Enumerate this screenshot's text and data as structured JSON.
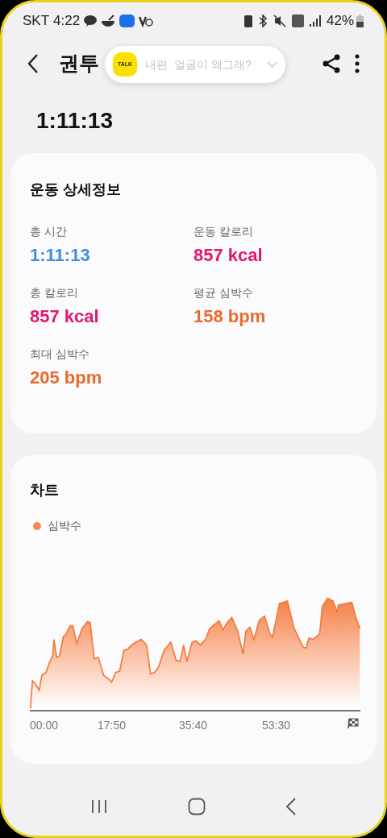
{
  "status_bar": {
    "carrier": "SKT",
    "time": "4:22",
    "battery": "42%"
  },
  "notification": {
    "logo": "TALK",
    "sender": "내편",
    "message": "얼굴이 왜그래?"
  },
  "header": {
    "title": "권투"
  },
  "duration": "1:11:13",
  "details": {
    "title": "운동 상세정보",
    "items": [
      {
        "label": "총 시간",
        "value": "1:11:13",
        "color": "#3d8fe0"
      },
      {
        "label": "운동 칼로리",
        "value": "857 kcal",
        "color": "#e3176d"
      },
      {
        "label": "총 칼로리",
        "value": "857 kcal",
        "color": "#e3176d"
      },
      {
        "label": "평균 심박수",
        "value": "158 bpm",
        "color": "#ea6a2c"
      },
      {
        "label": "최대 심박수",
        "value": "205 bpm",
        "color": "#ea6a2c"
      }
    ]
  },
  "chart": {
    "title": "차트",
    "legend": {
      "label": "심박수",
      "color": "#f5894f"
    },
    "x_labels": [
      "00:00",
      "17:50",
      "35:40",
      "53:30"
    ]
  }
}
